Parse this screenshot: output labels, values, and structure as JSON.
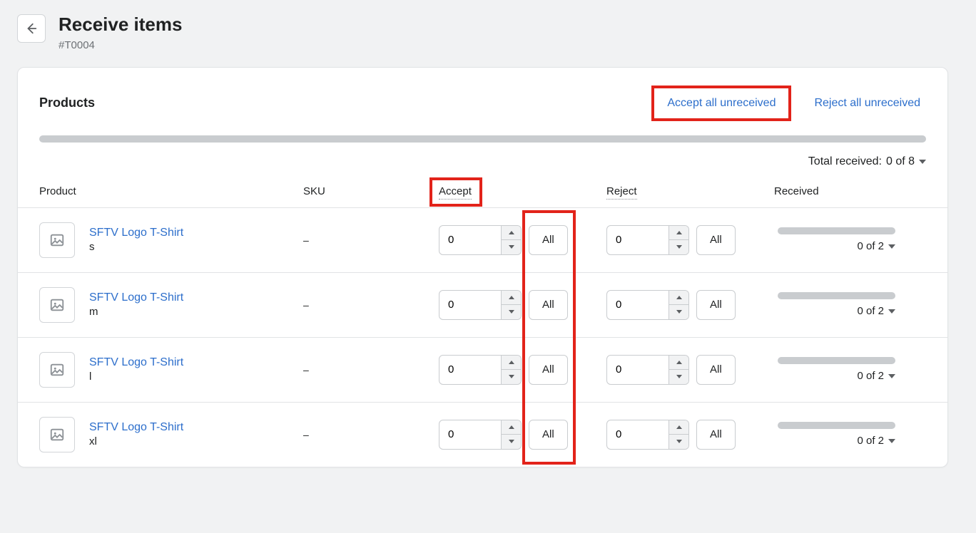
{
  "header": {
    "title": "Receive items",
    "subtitle": "#T0004"
  },
  "card": {
    "title": "Products",
    "accept_all": "Accept all unreceived",
    "reject_all": "Reject all unreceived",
    "total_received_label": "Total received:",
    "total_received_value": "0 of 8"
  },
  "columns": {
    "product": "Product",
    "sku": "SKU",
    "accept": "Accept",
    "reject": "Reject",
    "received": "Received"
  },
  "labels": {
    "all": "All"
  },
  "rows": [
    {
      "name": "SFTV Logo T-Shirt",
      "variant": "s",
      "sku": "–",
      "accept": "0",
      "reject": "0",
      "received": "0 of 2"
    },
    {
      "name": "SFTV Logo T-Shirt",
      "variant": "m",
      "sku": "–",
      "accept": "0",
      "reject": "0",
      "received": "0 of 2"
    },
    {
      "name": "SFTV Logo T-Shirt",
      "variant": "l",
      "sku": "–",
      "accept": "0",
      "reject": "0",
      "received": "0 of 2"
    },
    {
      "name": "SFTV Logo T-Shirt",
      "variant": "xl",
      "sku": "–",
      "accept": "0",
      "reject": "0",
      "received": "0 of 2"
    }
  ]
}
